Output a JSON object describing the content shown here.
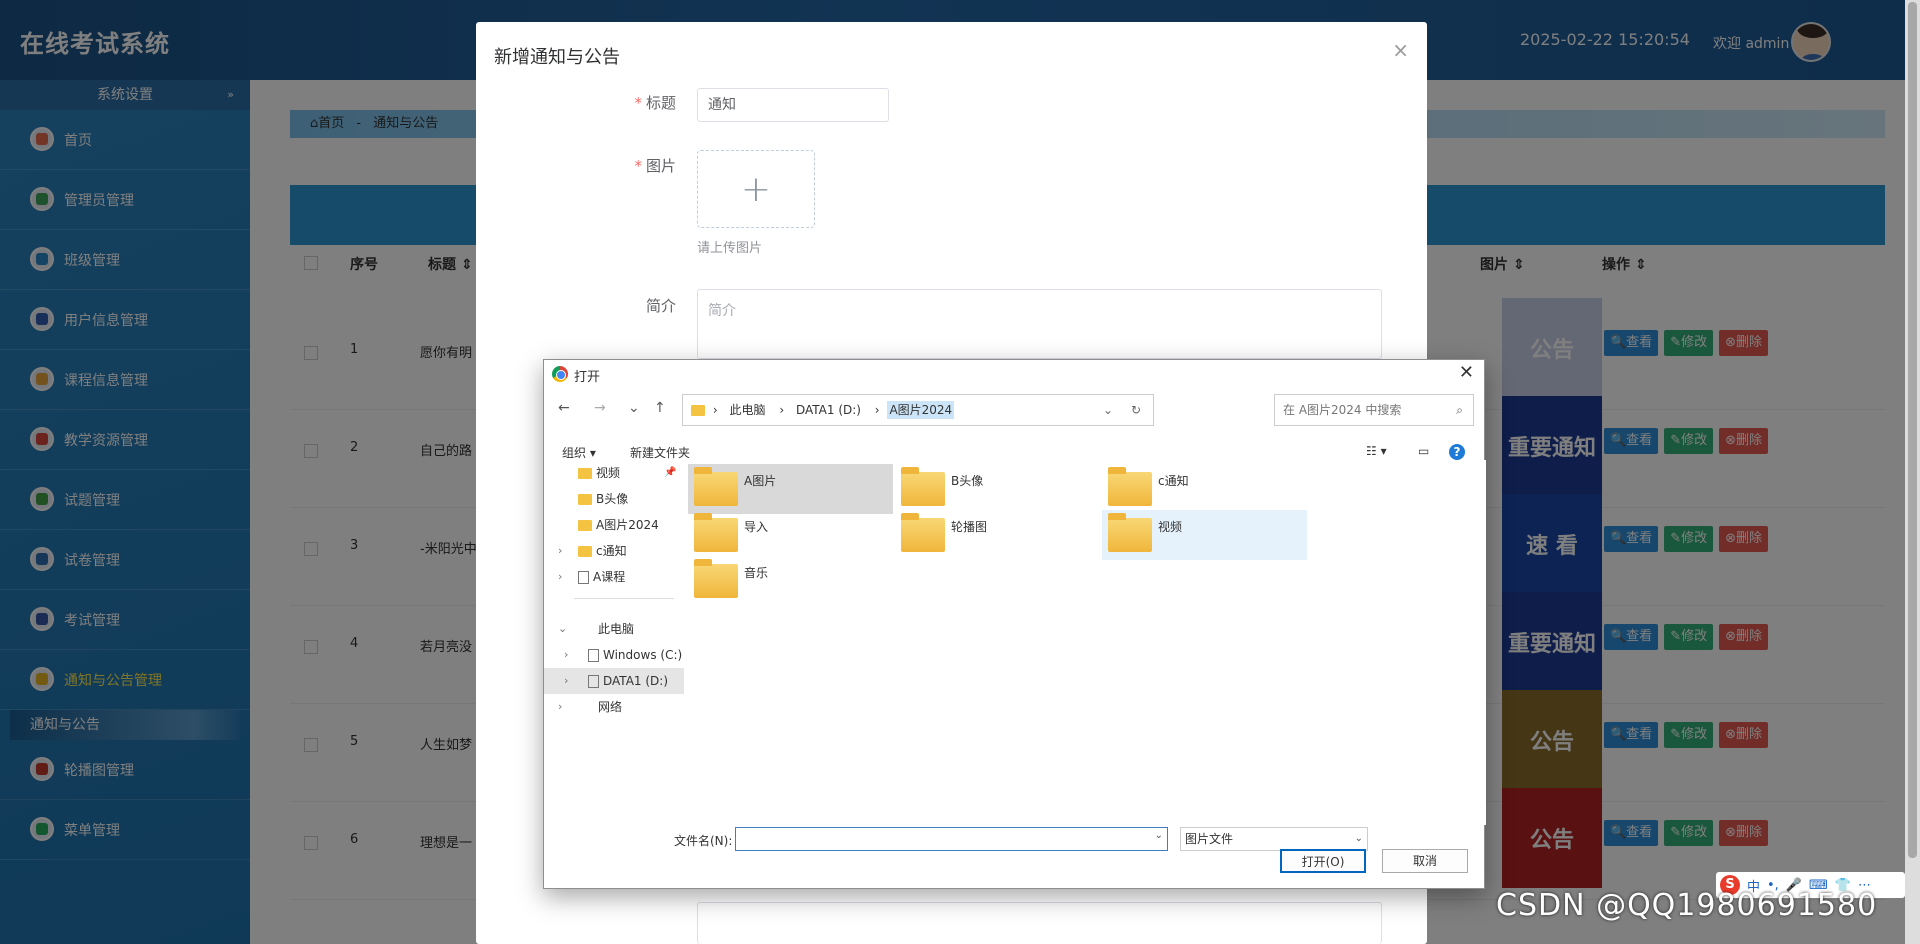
{
  "header": {
    "title": "在线考试系统",
    "datetime": "2025-02-22 15:20:54",
    "welcome": "欢迎 admin"
  },
  "sidebar": {
    "section": "系统设置",
    "collapse": "»",
    "items": [
      {
        "label": "首页",
        "icon": "home-icon",
        "color": "#e56b4d"
      },
      {
        "label": "管理员管理",
        "icon": "admin-icon",
        "color": "#3aa55b"
      },
      {
        "label": "班级管理",
        "icon": "class-icon",
        "color": "#2b87c6"
      },
      {
        "label": "用户信息管理",
        "icon": "user-icon",
        "color": "#2f5fb3"
      },
      {
        "label": "课程信息管理",
        "icon": "course-icon",
        "color": "#e8a53a"
      },
      {
        "label": "教学资源管理",
        "icon": "resource-icon",
        "color": "#d9473d"
      },
      {
        "label": "试题管理",
        "icon": "question-icon",
        "color": "#43a047"
      },
      {
        "label": "试卷管理",
        "icon": "paper-icon",
        "color": "#2c6fb0"
      },
      {
        "label": "考试管理",
        "icon": "exam-icon",
        "color": "#3457a8"
      },
      {
        "label": "通知与公告管理",
        "icon": "notice-icon",
        "color": "#e6b422"
      }
    ],
    "submenu": "通知与公告",
    "items2": [
      {
        "label": "轮播图管理",
        "icon": "carousel-icon",
        "color": "#c0392b"
      },
      {
        "label": "菜单管理",
        "icon": "menu-icon",
        "color": "#27ae60"
      }
    ]
  },
  "main": {
    "breadcrumb": {
      "home": "⌂首页",
      "sep": "-",
      "current": "通知与公告"
    },
    "table": {
      "headers": {
        "no": "序号",
        "title": "标题 ⇕",
        "image": "图片 ⇕",
        "ops": "操作 ⇕"
      },
      "rows": [
        {
          "no": "1",
          "title": "愿你有明",
          "thumb": "公告",
          "bg": "#c9cfe8"
        },
        {
          "no": "2",
          "title": "自己的路",
          "thumb": "重要通知",
          "bg": "#1d3a92"
        },
        {
          "no": "3",
          "title": "-米阳光中",
          "thumb": "速 看",
          "bg": "#1847a6"
        },
        {
          "no": "4",
          "title": "若月亮没",
          "thumb": "重要通知",
          "bg": "#1d3a92"
        },
        {
          "no": "5",
          "title": "人生如梦",
          "thumb": "公告",
          "bg": "#8a6d2b"
        },
        {
          "no": "6",
          "title": "理想是一",
          "thumb": "公告",
          "bg": "#b32222"
        }
      ],
      "btn_view": "🔍查看",
      "btn_edit": "✎修改",
      "btn_delete": "⊗删除"
    }
  },
  "modal": {
    "title": "新增通知与公告",
    "close": "×",
    "fields": {
      "title_label": "标题",
      "title_value": "通知",
      "image_label": "图片",
      "upload_plus": "+",
      "upload_hint": "请上传图片",
      "intro_label": "简介",
      "intro_placeholder": "简介"
    }
  },
  "file_dialog": {
    "title": "打开",
    "close": "✕",
    "nav": {
      "back": "←",
      "forward": "→",
      "down": "⌄",
      "up": "↑"
    },
    "path": [
      "此电脑",
      "DATA1 (D:)",
      "A图片2024"
    ],
    "path_sep": "›",
    "search_placeholder": "在 A图片2024 中搜索",
    "toolbar": {
      "organize": "组织 ▾",
      "new_folder": "新建文件夹",
      "view": "☷ ▾",
      "pane": "▭",
      "help": "?"
    },
    "tree": [
      {
        "label": "视频",
        "pin": "📌"
      },
      {
        "label": "B头像"
      },
      {
        "label": "A图片2024"
      },
      {
        "label": "c通知",
        "ex": "›"
      },
      {
        "label": "A课程",
        "ex": "›"
      },
      {
        "label": "此电脑",
        "ex": "⌄"
      },
      {
        "label": "Windows (C:)",
        "ex": "›"
      },
      {
        "label": "DATA1 (D:)",
        "ex": "›"
      },
      {
        "label": "网络",
        "ex": "›"
      }
    ],
    "folders": [
      "A图片",
      "B头像",
      "c通知",
      "导入",
      "轮播图",
      "视频",
      "音乐"
    ],
    "filename_label": "文件名(N):",
    "filetype": "图片文件",
    "open_button": "打开(O)",
    "cancel_button": "取消"
  },
  "ime": {
    "s": "S",
    "items": [
      "中",
      "•,",
      "🎤",
      "⌨",
      "👕",
      "⋯"
    ]
  },
  "watermark": "CSDN @QQ1980691580"
}
